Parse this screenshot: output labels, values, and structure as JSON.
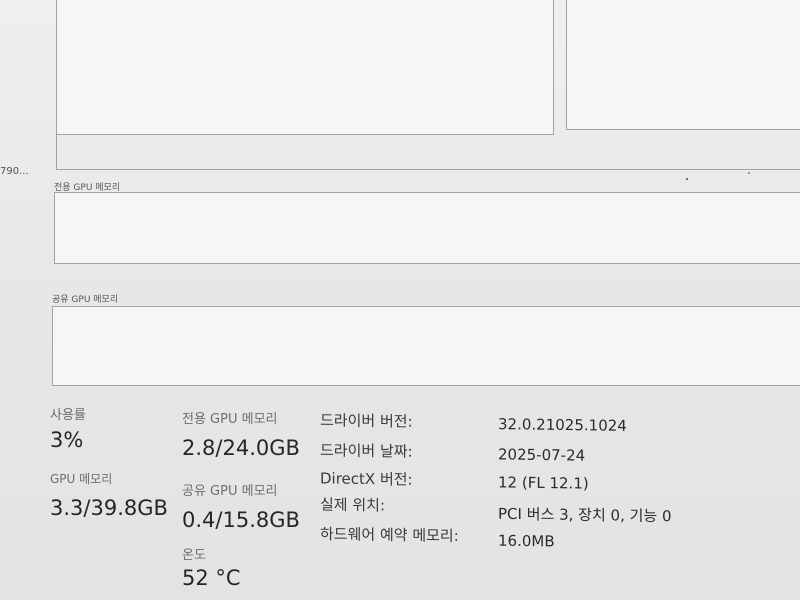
{
  "left_cut_text": "790...",
  "graphs": {
    "dedicated_label": "전용 GPU 메모리",
    "shared_label": "공유 GPU 메모리"
  },
  "stats": {
    "utilization": {
      "label": "사용률",
      "value": "3%"
    },
    "gpu_memory": {
      "label": "GPU 메모리",
      "value": "3.3/39.8GB"
    },
    "dedicated_memory": {
      "label": "전용 GPU 메모리",
      "value": "2.8/24.0GB"
    },
    "shared_memory": {
      "label": "공유 GPU 메모리",
      "value": "0.4/15.8GB"
    },
    "temperature": {
      "label": "온도",
      "value": "52 °C"
    }
  },
  "info": {
    "driver_version": {
      "label": "드라이버 버전:",
      "value": "32.0.21025.1024"
    },
    "driver_date": {
      "label": "드라이버 날짜:",
      "value": "2025-07-24"
    },
    "directx_version": {
      "label": "DirectX 버전:",
      "value": "12 (FL 12.1)"
    },
    "physical_location": {
      "label": "실제 위치:",
      "value": "PCI 버스 3, 장치 0, 기능 0"
    },
    "reserved_memory": {
      "label": "하드웨어 예약 메모리:",
      "value": "16.0MB"
    }
  }
}
